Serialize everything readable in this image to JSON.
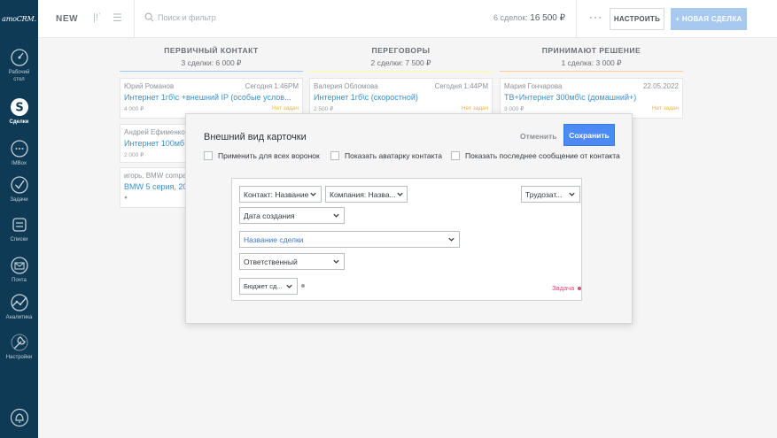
{
  "sidebar": {
    "logo": "amoCRM.",
    "items": [
      {
        "label_l1": "Рабочий",
        "label_l2": "стол",
        "icon": "dashboard-icon"
      },
      {
        "label_l1": "Сделки",
        "label_l2": "",
        "icon": "deals-icon"
      },
      {
        "label_l1": "IMBox",
        "label_l2": "",
        "icon": "chat-icon"
      },
      {
        "label_l1": "Задачи",
        "label_l2": "",
        "icon": "check-circle-icon"
      },
      {
        "label_l1": "Списки",
        "label_l2": "",
        "icon": "list-icon"
      },
      {
        "label_l1": "Почта",
        "label_l2": "",
        "icon": "mail-icon"
      },
      {
        "label_l1": "Аналитика",
        "label_l2": "",
        "icon": "analytics-icon"
      },
      {
        "label_l1": "Настройки",
        "label_l2": "",
        "icon": "settings-icon"
      }
    ],
    "bottom_icon": "bell-icon"
  },
  "topbar": {
    "title": "NEW",
    "search_placeholder": "Поиск и фильтр",
    "summary_label": "6 сделок:",
    "summary_value": "16 500 ₽",
    "more_label": "···",
    "setup_label": "НАСТРОИТЬ",
    "new_deal_label": "+ НОВАЯ СДЕЛКА"
  },
  "pipeline": {
    "columns": [
      {
        "title": "ПЕРВИЧНЫЙ КОНТАКТ",
        "subtitle": "3 сделки: 6 000 ₽",
        "color": "#99ccff"
      },
      {
        "title": "ПЕРЕГОВОРЫ",
        "subtitle": "2 сделки: 7 500 ₽",
        "color": "#ffff99"
      },
      {
        "title": "ПРИНИМАЮТ РЕШЕНИЕ",
        "subtitle": "1 сделка: 3 000 ₽",
        "color": "#ffcc99"
      }
    ],
    "cards": [
      {
        "name": "Юрий Романов",
        "date": "Сегодня 1:46PM",
        "title": "Интернет 1гб\\с +внешний IP (особые услов...",
        "price": "4 000 ₽",
        "status": "Нет задач"
      },
      {
        "name": "Андрей Ефименко",
        "date": "",
        "title": "Интернет 100мб",
        "price": "2 000 ₽",
        "status": ""
      },
      {
        "name": "игорь, BMW compa",
        "date": "",
        "title": "BMW 5 серия, 20",
        "price": "",
        "status": ""
      },
      {
        "name": "Валерия Обломова",
        "date": "Сегодня 1:44PM",
        "title": "Интернет 1гб\\с (скоростной)",
        "price": "2 500 ₽",
        "status": "Нет задач"
      },
      {
        "name": "Мария Гончарова",
        "date": "22.05.2022",
        "title": "ТВ+Интернет 300мб\\с (домашний+)",
        "price": "3 000 ₽",
        "status": "Нет задач"
      }
    ]
  },
  "modal": {
    "title": "Внешний вид карточки",
    "cancel_label": "Отменить",
    "save_label": "Сохранить",
    "checks": [
      {
        "label": "Применить для всех воронок",
        "checked": false
      },
      {
        "label": "Показать аватарку контакта",
        "checked": false
      },
      {
        "label": "Показать последнее сообщение от контакта",
        "checked": false
      }
    ],
    "preview": {
      "contact_field": "Контакт: Название",
      "company_field": "Компания: Назва...",
      "labor_field": "Трудозат...",
      "date_field": "Дата создания",
      "deal_name_field": "Название сделки",
      "responsible_field": "Ответственный",
      "budget_field": "Бюджет сд...",
      "task_label": "Задача"
    }
  }
}
